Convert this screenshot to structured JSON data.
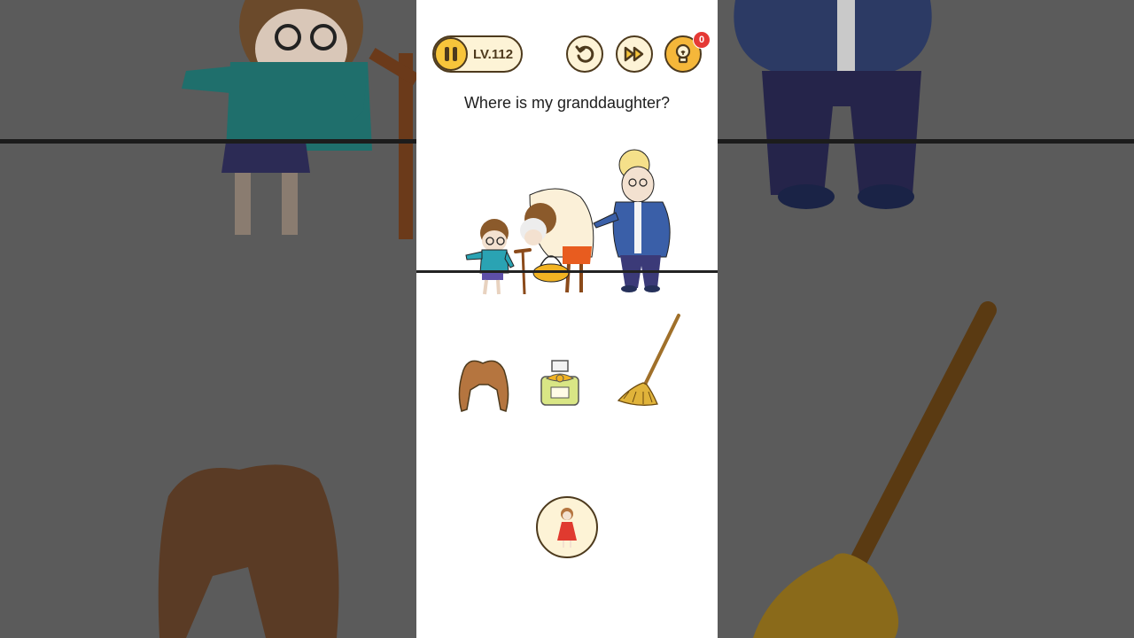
{
  "header": {
    "level_label": "LV.112",
    "hint_count": "0"
  },
  "question": "Where is my granddaughter?",
  "icons": {
    "pause": "pause-icon",
    "restart": "restart-icon",
    "skip": "skip-icon",
    "hint": "lightbulb-icon"
  },
  "items": [
    "wig",
    "perfume-bottle",
    "mop"
  ],
  "target": "granddaughter",
  "colors": {
    "accent": "#f7c53b",
    "button_bg": "#fdf3d6",
    "outline": "#4d3a1d",
    "badge": "#e53935"
  }
}
